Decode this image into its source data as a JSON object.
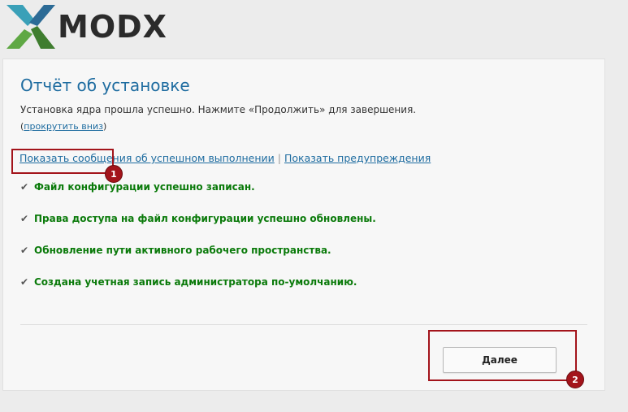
{
  "brand": {
    "logo_text": "MODX",
    "logo_icon": "modx-x-logo-icon",
    "colors": {
      "green": "#5fa844",
      "dark_green": "#3f7d2f",
      "blue": "#2c6b96",
      "teal": "#3aa0b8"
    }
  },
  "report": {
    "title": "Отчёт об установке",
    "description": "Установка ядра прошла успешно. Нажмите «Продолжить» для завершения.",
    "scroll_open": "(",
    "scroll_link": "прокрутить вниз",
    "scroll_close": ")",
    "show_success_link": "Показать сообщения об успешном выполнении",
    "separator": "|",
    "show_warnings_link": "Показать предупреждения",
    "messages": [
      "Файл конфигурации успешно записан.",
      "Права доступа на файл конфигурации успешно обновлены.",
      "Обновление пути активного рабочего пространства.",
      "Создана учетная запись администратора по-умолчанию."
    ],
    "next_button": "Далее"
  },
  "annotations": {
    "badge_1": "1",
    "badge_2": "2",
    "highlight_color": "#a3141b"
  }
}
